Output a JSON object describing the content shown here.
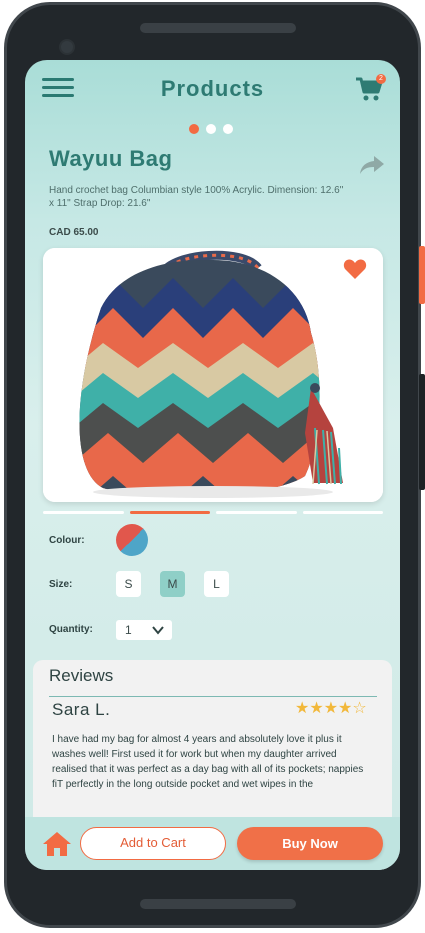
{
  "header": {
    "title": "Products",
    "cart_count": "2",
    "menu_icon": "hamburger-menu-icon",
    "cart_icon": "shopping-cart-icon"
  },
  "carousel": {
    "pages": 3,
    "active_index": 0
  },
  "product": {
    "name": "Wayuu Bag",
    "description": "Hand crochet bag Columbian style 100% Acrylic. Dimension: 12.6\" x 11\" Strap Drop: 21.6\"",
    "price": "CAD 65.00",
    "favourite": true
  },
  "gallery": {
    "tabs": 4,
    "active_index": 1
  },
  "options": {
    "colour_label": "Colour:",
    "size_label": "Size:",
    "sizes": [
      "S",
      "M",
      "L"
    ],
    "selected_size": "M",
    "quantity_label": "Quantity:",
    "quantity_value": "1"
  },
  "reviews": {
    "title": "Reviews",
    "items": [
      {
        "author": "Sara L.",
        "rating": 4.5,
        "stars_text": "★★★★☆",
        "text": "I have had my bag for almost 4 years and absolutely love it plus it washes well! First used it for work but when my daughter arrived realised that it was perfect as a day bag with all of its pockets; nappies fiT perfectly in the long outside pocket and wet wipes in the"
      }
    ]
  },
  "bottom_bar": {
    "add_to_cart": "Add to Cart",
    "buy_now": "Buy Now",
    "home_icon": "home-icon"
  },
  "colors": {
    "accent": "#f26b43",
    "brand_teal": "#2e7b73",
    "screen_bg": "#c6e8e5"
  }
}
